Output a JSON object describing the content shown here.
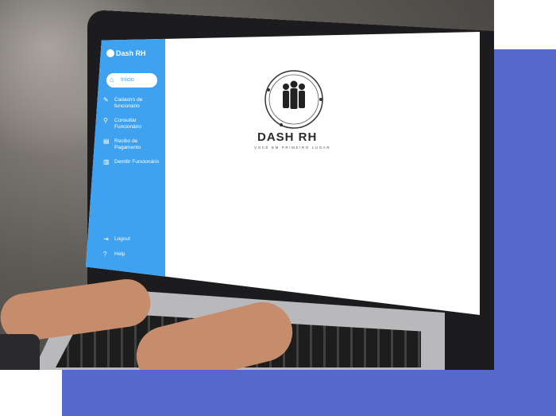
{
  "app": {
    "brand_name": "Dash RH",
    "logo_title": "DASH RH",
    "logo_tagline": "VOCÊ EM PRIMEIRO LUGAR"
  },
  "sidebar": {
    "items": [
      {
        "label": "Início",
        "icon": "home-icon",
        "active": true
      },
      {
        "label": "Cadastro de funcionário",
        "icon": "add-user-icon"
      },
      {
        "label": "Consultar Funcionário",
        "icon": "search-icon"
      },
      {
        "label": "Recibo de Pagamento",
        "icon": "receipt-icon"
      },
      {
        "label": "Demitir Funcionário",
        "icon": "dismiss-icon"
      }
    ],
    "footer": [
      {
        "label": "Logout",
        "icon": "logout-icon"
      },
      {
        "label": "Help",
        "icon": "help-icon"
      }
    ]
  },
  "colors": {
    "accent_block": "#5668cc",
    "sidebar": "#3ea2f0"
  }
}
